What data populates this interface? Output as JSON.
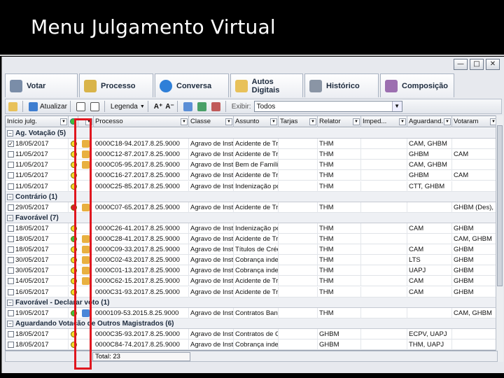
{
  "slide": {
    "title": "Menu Julgamento Virtual"
  },
  "window": {
    "minimize": "—",
    "maximize": "□",
    "close": "✕"
  },
  "tabs": [
    {
      "label": "Votar",
      "icon": "vote-icon",
      "color": "#7a8da8"
    },
    {
      "label": "Processo",
      "icon": "document-icon",
      "color": "#d9b44a"
    },
    {
      "label": "Conversa",
      "icon": "chat-bubble-icon",
      "color": "#2f7fd8"
    },
    {
      "label": "Autos Digitais",
      "icon": "folder-icon",
      "color": "#e8c15a"
    },
    {
      "label": "Histórico",
      "icon": "history-icon",
      "color": "#8a95a5"
    },
    {
      "label": "Composição",
      "icon": "people-icon",
      "color": "#9c6fb0"
    }
  ],
  "toolbar": {
    "atualizar": "Atualizar",
    "legenda": "Legenda",
    "exibir_label": "Exibir:",
    "exibir_value": "Todos"
  },
  "columns": [
    "Início julg.",
    "",
    "",
    "Processo",
    "Classe",
    "Assunto",
    "Tarjas",
    "Relator",
    "Imped...",
    "Aguardand...",
    "Votaram"
  ],
  "groups": [
    {
      "label": "Ag. Votação (5)",
      "rows": [
        {
          "checked": true,
          "date": "18/05/2017",
          "dot": "yellow",
          "tick": "orange",
          "processo": "0000C18-94.2017.8.25.9000",
          "classe": "Agravo de Instru",
          "assunto": "Acidente de Trãl",
          "relator": "THM",
          "aguardando": "CAM, GHBM",
          "votaram": ""
        },
        {
          "checked": false,
          "date": "11/05/2017",
          "dot": "yellow",
          "tick": "orange",
          "processo": "0000C12-87.2017.8.25.9000",
          "classe": "Agravo de Instru",
          "assunto": "Acidente de Trãl",
          "relator": "THM",
          "aguardando": "GHBM",
          "votaram": "CAM"
        },
        {
          "checked": false,
          "date": "11/05/2017",
          "dot": "yellow",
          "tick": "orange",
          "processo": "0000C05-95.2017.8.25.9000",
          "classe": "Agravo de Instru",
          "assunto": "Bem de Família",
          "relator": "THM",
          "aguardando": "CAM, GHBM",
          "votaram": ""
        },
        {
          "checked": false,
          "date": "11/05/2017",
          "dot": "yellow",
          "tick": "",
          "processo": "0000C16-27.2017.8.25.9000",
          "classe": "Agravo de Instru",
          "assunto": "Acidente de Trãl",
          "relator": "THM",
          "aguardando": "GHBM",
          "votaram": "CAM"
        },
        {
          "checked": false,
          "date": "11/05/2017",
          "dot": "yellow",
          "tick": "",
          "processo": "0000C25-85.2017.8.25.9000",
          "classe": "Agravo de Instru",
          "assunto": "Indenização por",
          "relator": "THM",
          "aguardando": "CTT, GHBM",
          "votaram": ""
        }
      ]
    },
    {
      "label": "Contrário (1)",
      "rows": [
        {
          "checked": false,
          "date": "29/05/2017",
          "dot": "red",
          "tick": "orange",
          "processo": "0000C07-65.2017.8.25.9000",
          "classe": "Agravo de Instru",
          "assunto": "Acidente de Trãl",
          "relator": "THM",
          "aguardando": "",
          "votaram": "GHBM (Des), UA"
        }
      ]
    },
    {
      "label": "Favorável (7)",
      "rows": [
        {
          "checked": false,
          "date": "18/05/2017",
          "dot": "yellow",
          "tick": "",
          "processo": "0000C26-41.2017.8.25.9000",
          "classe": "Agravo de Instru",
          "assunto": "Indenização por",
          "relator": "THM",
          "aguardando": "CAM",
          "votaram": "GHBM"
        },
        {
          "checked": false,
          "date": "18/05/2017",
          "dot": "green",
          "tick": "orange",
          "processo": "0000C28-41.2017.8.25.9000",
          "classe": "Agravo de Instru",
          "assunto": "Acidente de Trãl",
          "relator": "THM",
          "aguardando": "",
          "votaram": "CAM, GHBM"
        },
        {
          "checked": false,
          "date": "18/05/2017",
          "dot": "yellow",
          "tick": "orange",
          "processo": "0000C09-33.2017.8.25.9000",
          "classe": "Agravo de Instru",
          "assunto": "Títulos de Crédit",
          "relator": "THM",
          "aguardando": "CAM",
          "votaram": "GHBM"
        },
        {
          "checked": false,
          "date": "30/05/2017",
          "dot": "yellow",
          "tick": "orange",
          "processo": "0000C02-43.2017.8.25.9000",
          "classe": "Agravo de Instru",
          "assunto": "Cobrança indevi",
          "relator": "THM",
          "aguardando": "LTS",
          "votaram": "GHBM"
        },
        {
          "checked": false,
          "date": "30/05/2017",
          "dot": "yellow",
          "tick": "orange",
          "processo": "0000C01-13.2017.8.25.9000",
          "classe": "Agravo de Instru",
          "assunto": "Cobrança indevi",
          "relator": "THM",
          "aguardando": "UAPJ",
          "votaram": "GHBM"
        },
        {
          "checked": false,
          "date": "14/05/2017",
          "dot": "yellow",
          "tick": "orange",
          "processo": "0000C62-15.2017.8.25.9000",
          "classe": "Agravo de Instru",
          "assunto": "Acidente de Trãl",
          "relator": "THM",
          "aguardando": "CAM",
          "votaram": "GHBM"
        },
        {
          "checked": false,
          "date": "16/05/2017",
          "dot": "yellow",
          "tick": "",
          "processo": "0000C31-93.2017.8.25.9000",
          "classe": "Agravo de Instru",
          "assunto": "Acidente de Trãl",
          "relator": "THM",
          "aguardando": "CAM",
          "votaram": "GHBM"
        }
      ]
    },
    {
      "label": "Favorável - Declarar voto (1)",
      "rows": [
        {
          "checked": false,
          "date": "19/05/2017",
          "dot": "green",
          "tick": "blue",
          "processo": "0000109-53.2015.8.25.9000",
          "classe": "Agravo de Instru",
          "assunto": "Contratos Bancá",
          "relator": "THM",
          "aguardando": "",
          "votaram": "CAM, GHBM"
        }
      ]
    },
    {
      "label": "Aguardando Votação de Outros Magistrados (6)",
      "rows": [
        {
          "checked": false,
          "date": "18/05/2017",
          "dot": "yellow",
          "tick": "",
          "processo": "0000C35-93.2017.8.25.9000",
          "classe": "Agravo de Instru",
          "assunto": "Contratos de Cor",
          "relator": "GHBM",
          "aguardando": "ECPV, UAPJ",
          "votaram": ""
        },
        {
          "checked": false,
          "date": "18/05/2017",
          "dot": "yellow",
          "tick": "",
          "processo": "0000C84-74.2017.8.25.9000",
          "classe": "Agravo de Instru",
          "assunto": "Cobrança indevi",
          "relator": "GHBM",
          "aguardando": "THM, UAPJ",
          "votaram": ""
        }
      ]
    }
  ],
  "footer": {
    "total": "Total: 23"
  },
  "colors": {
    "yellow": "#f2dc2b",
    "green": "#3fbf3f",
    "red": "#d3242a",
    "orange": "#e8b040",
    "blue": "#4a86d8",
    "highlight": "#e0171f"
  }
}
